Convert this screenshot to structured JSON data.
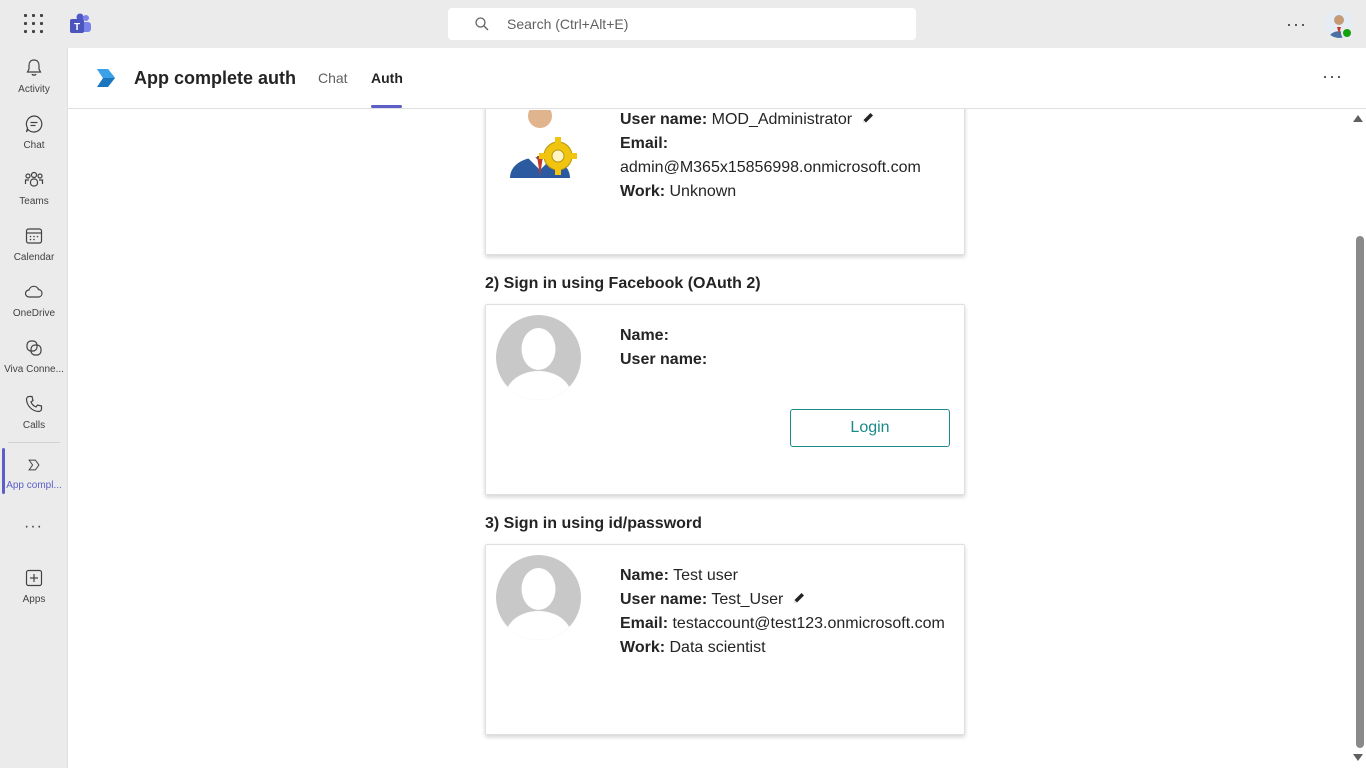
{
  "topbar": {
    "search_placeholder": "Search (Ctrl+Alt+E)",
    "more": "···"
  },
  "rail": {
    "items": [
      {
        "label": "Activity",
        "icon": "bell-icon"
      },
      {
        "label": "Chat",
        "icon": "chat-icon"
      },
      {
        "label": "Teams",
        "icon": "teams-icon"
      },
      {
        "label": "Calendar",
        "icon": "calendar-icon"
      },
      {
        "label": "OneDrive",
        "icon": "cloud-icon"
      },
      {
        "label": "Viva Conne...",
        "icon": "viva-icon"
      },
      {
        "label": "Calls",
        "icon": "phone-icon"
      },
      {
        "label": "App compl...",
        "icon": "app-icon"
      },
      {
        "label": "Apps",
        "icon": "add-app-icon"
      }
    ],
    "more": "···"
  },
  "app": {
    "title": "App complete auth",
    "tabs": [
      {
        "label": "Chat"
      },
      {
        "label": "Auth",
        "active": true
      }
    ],
    "more": "···"
  },
  "section1": {
    "username_label": "User name:",
    "username": "MOD_Administrator",
    "email_label": "Email:",
    "email": "admin@M365x15856998.onmicrosoft.com",
    "work_label": "Work:",
    "work": "Unknown"
  },
  "section2": {
    "title": "2) Sign in using Facebook (OAuth 2)",
    "name_label": "Name:",
    "username_label": "User name:",
    "login_label": "Login"
  },
  "section3": {
    "title": "3) Sign in using id/password",
    "name_label": "Name:",
    "name": "Test user",
    "username_label": "User name:",
    "username": "Test_User",
    "email_label": "Email:",
    "email": "testaccount@test123.onmicrosoft.com",
    "work_label": "Work:",
    "work": "Data scientist"
  },
  "colors": {
    "accent": "#5b5fc7",
    "login_border": "#1b8a8a",
    "presence": "#13a10e"
  }
}
